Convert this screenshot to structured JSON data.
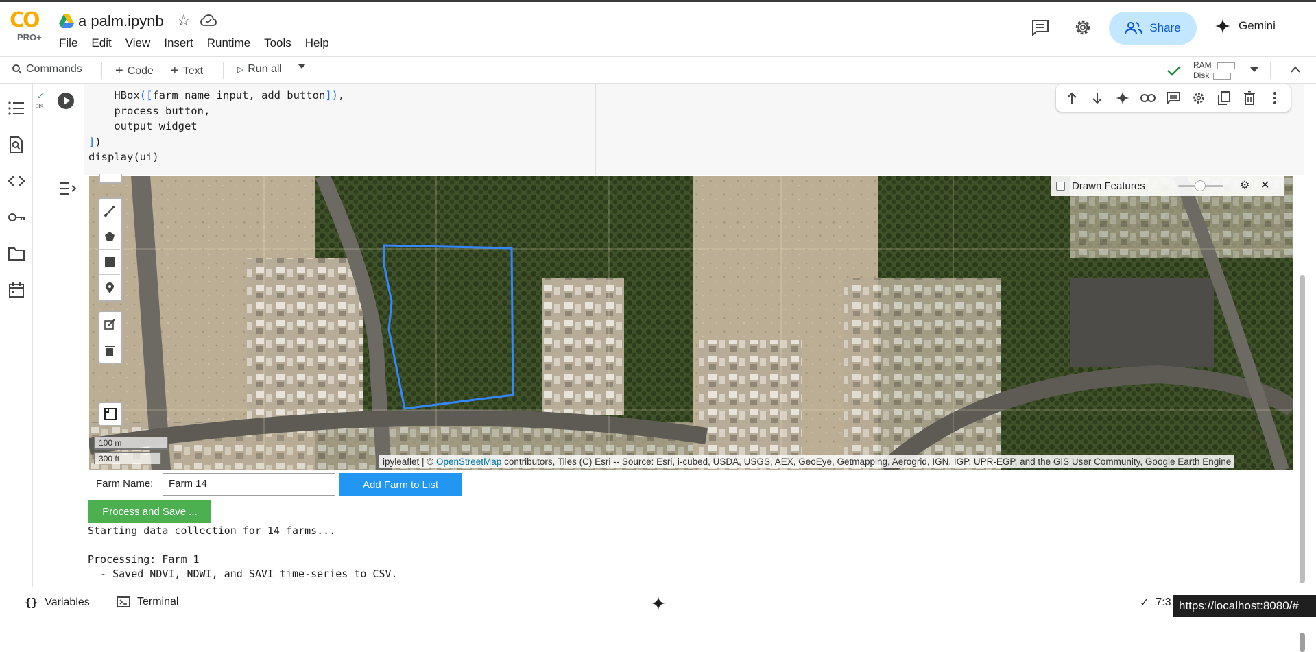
{
  "header": {
    "logo_text": "CO",
    "logo_sub": "PRO+",
    "notebook_title": "a palm.ipynb",
    "menu": [
      "File",
      "Edit",
      "View",
      "Insert",
      "Runtime",
      "Tools",
      "Help"
    ],
    "share_label": "Share",
    "gemini_label": "Gemini"
  },
  "toolbar": {
    "commands_label": "Commands",
    "code_label": "Code",
    "text_label": "Text",
    "run_all_label": "Run all",
    "ram_label": "RAM",
    "disk_label": "Disk"
  },
  "cell": {
    "exec_time": "3s",
    "code_lines": [
      "    HBox([farm_name_input, add_button]),",
      "    process_button,",
      "    output_widget",
      "])",
      "display(ui)"
    ]
  },
  "map": {
    "layer_name": "Drawn Features",
    "scale_metric": "100 m",
    "scale_imperial": "300 ft",
    "attribution_prefix": "ipyleaflet | ©",
    "attribution_link": "OpenStreetMap",
    "attribution_suffix": "contributors, Tiles (C) Esri -- Source: Esri, i-cubed, USDA, USGS, AEX, GeoEye, Getmapping, Aerogrid, IGN, IGP, UPR-EGP, and the GIS User Community, Google Earth Engine",
    "polygon_color": "#3388ff"
  },
  "widgets": {
    "farm_name_label": "Farm Name:",
    "farm_name_value": "Farm 14",
    "add_button_label": "Add Farm to List",
    "process_button_label": "Process and Save ..."
  },
  "output_lines": [
    "Starting data collection for 14 farms...",
    "",
    "Processing: Farm 1",
    "  - Saved NDVI, NDWI, and SAVI time-series to CSV."
  ],
  "statusbar": {
    "variables_label": "Variables",
    "terminal_label": "Terminal",
    "time_partial": "7:3",
    "url_tooltip": "https://localhost:8080/#"
  },
  "colors": {
    "accent_blue": "#2196f3",
    "accent_green": "#4caf50",
    "share_bg": "#c2e7ff",
    "logo_orange": "#f9ab00"
  }
}
